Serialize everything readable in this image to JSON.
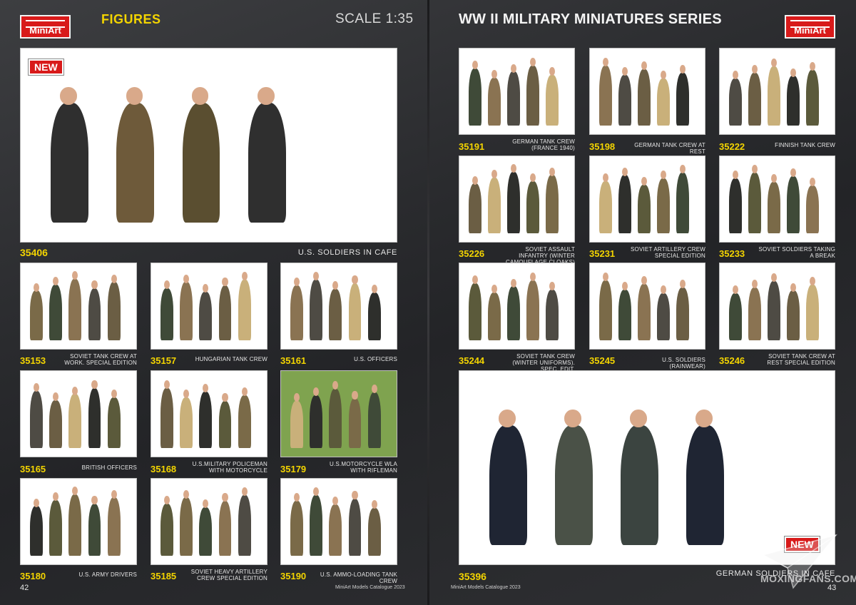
{
  "header": {
    "brand": "MiniArt",
    "section": "FIGURES",
    "scale": "SCALE 1:35",
    "series": "WW II MILITARY MINIATURES SERIES"
  },
  "badge_new": "NEW",
  "products": [
    {
      "num": "35406",
      "name": "U.S. SOLDIERS IN CAFE",
      "new": true
    },
    {
      "num": "35153",
      "name": "SOVIET TANK CREW AT WORK. SPECIAL EDITION"
    },
    {
      "num": "35157",
      "name": "HUNGARIAN TANK CREW"
    },
    {
      "num": "35161",
      "name": "U.S. OFFICERS"
    },
    {
      "num": "35165",
      "name": "BRITISH OFFICERS"
    },
    {
      "num": "35168",
      "name": "U.S.MILITARY POLICEMAN WITH MOTORCYCLE"
    },
    {
      "num": "35179",
      "name": "U.S.MOTORCYCLE WLA WITH RIFLEMAN"
    },
    {
      "num": "35180",
      "name": "U.S. ARMY DRIVERS"
    },
    {
      "num": "35185",
      "name": "SOVIET HEAVY ARTILLERY CREW SPECIAL EDITION"
    },
    {
      "num": "35190",
      "name": "U.S. AMMO-LOADING TANK CREW"
    },
    {
      "num": "35191",
      "name": "GERMAN TANK CREW (FRANCE 1940)"
    },
    {
      "num": "35198",
      "name": "GERMAN TANK CREW AT REST"
    },
    {
      "num": "35222",
      "name": "FINNISH TANK CREW"
    },
    {
      "num": "35226",
      "name": "SOVIET ASSAULT INFANTRY (WINTER CAMOUFLAGE CLOAKS)"
    },
    {
      "num": "35231",
      "name": "SOVIET ARTILLERY CREW SPECIAL EDITION"
    },
    {
      "num": "35233",
      "name": "SOVIET SOLDIERS TAKING A BREAK"
    },
    {
      "num": "35244",
      "name": "SOVIET TANK CREW (WINTER UNIFORMS). SPEC. EDIT."
    },
    {
      "num": "35245",
      "name": "U.S. SOLDIERS (RAINWEAR)"
    },
    {
      "num": "35246",
      "name": "SOVIET TANK CREW AT REST SPECIAL EDITION"
    },
    {
      "num": "35396",
      "name": "GERMAN SOLDIERS IN CAFE",
      "new": true
    }
  ],
  "footer": {
    "left_page": "42",
    "right_page": "43",
    "left_text": "MiniArt Models Catalogue 2023",
    "right_text": "MiniArt Models Catalogue 2023"
  },
  "watermark": "MOXINGFANS.COM",
  "colors": {
    "accent": "#f3d400",
    "brand_red": "#d81a1a",
    "background": "#2a2b2e"
  }
}
